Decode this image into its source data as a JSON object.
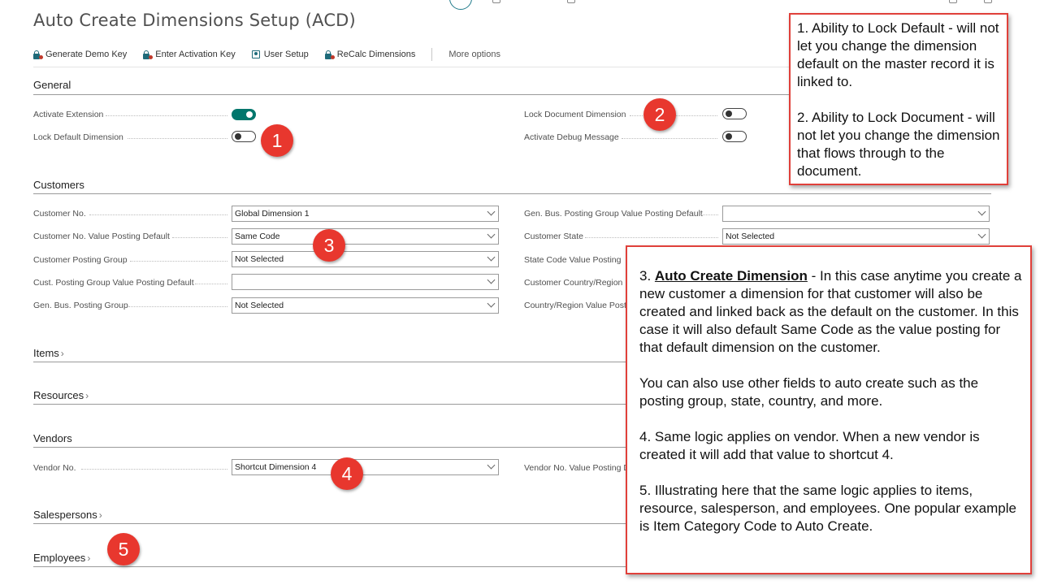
{
  "page": {
    "title": "Auto Create Dimensions Setup (ACD)"
  },
  "actions": [
    {
      "label": "Generate Demo Key",
      "icon": "lock-key-icon"
    },
    {
      "label": "Enter Activation Key",
      "icon": "lock-key-icon"
    },
    {
      "label": "User Setup",
      "icon": "user-setup-icon"
    },
    {
      "label": "ReCalc Dimensions",
      "icon": "lock-key-icon"
    }
  ],
  "more_options": "More options",
  "general": {
    "title": "General",
    "activate_extension": {
      "label": "Activate Extension",
      "value": true
    },
    "lock_default_dimension": {
      "label": "Lock Default Dimension",
      "value": false
    },
    "lock_document_dimension": {
      "label": "Lock Document Dimension",
      "value": false
    },
    "activate_debug_message": {
      "label": "Activate Debug Message",
      "value": false
    }
  },
  "customers": {
    "title": "Customers",
    "customer_no": {
      "label": "Customer No.",
      "value": "Global Dimension 1"
    },
    "customer_no_value_posting_default": {
      "label": "Customer No. Value Posting Default",
      "value": "Same Code"
    },
    "customer_posting_group": {
      "label": "Customer Posting Group",
      "value": "Not Selected"
    },
    "cust_posting_group_value_posting_default": {
      "label": "Cust. Posting Group Value Posting Default",
      "value": ""
    },
    "gen_bus_posting_group": {
      "label": "Gen. Bus. Posting Group",
      "value": "Not Selected"
    },
    "gen_bus_posting_group_value_posting_default": {
      "label": "Gen. Bus. Posting Group Value Posting Default",
      "value": ""
    },
    "customer_state": {
      "label": "Customer State",
      "value": "Not Selected"
    },
    "state_code_value_posting": {
      "label": "State Code Value Posting"
    },
    "customer_country_region": {
      "label": "Customer Country/Region"
    },
    "country_region_value_posting": {
      "label": "Country/Region Value Post"
    }
  },
  "items": {
    "title": "Items"
  },
  "resources": {
    "title": "Resources"
  },
  "vendors": {
    "title": "Vendors",
    "vendor_no": {
      "label": "Vendor No.",
      "value": "Shortcut Dimension 4"
    },
    "vendor_no_value_posting": {
      "label": "Vendor No. Value Posting D"
    }
  },
  "salespersons": {
    "title": "Salespersons"
  },
  "employees": {
    "title": "Employees"
  },
  "badges": [
    "1",
    "2",
    "3",
    "4",
    "5"
  ],
  "callout1": {
    "p1": "1. Ability to Lock Default - will not let you change the dimension default on the master record it is linked to.",
    "p2": "2. Ability to Lock Document - will not let you change the dimension that flows through to the document."
  },
  "callout2": {
    "p3_heading": "Auto Create Dimension",
    "p3_prefix": "3. ",
    "p3_body": " - In this case anytime you create a new customer a dimension for that customer will also be created and linked back as the default on the customer. In this case it will also default Same Code as the value posting for that default dimension on the customer.",
    "p3b": "You can also use other fields to auto create such as the posting group, state, country, and more.",
    "p4": "4. Same logic applies on vendor. When a new vendor is created it will add that value to shortcut 4.",
    "p5": "5. Illustrating here that the same logic applies to items, resource, salesperson, and employees. One popular example is Item Category Code to Auto Create."
  },
  "colors": {
    "accent": "#00766c",
    "badge": "#e8372e",
    "callout_border": "#e0403a"
  }
}
